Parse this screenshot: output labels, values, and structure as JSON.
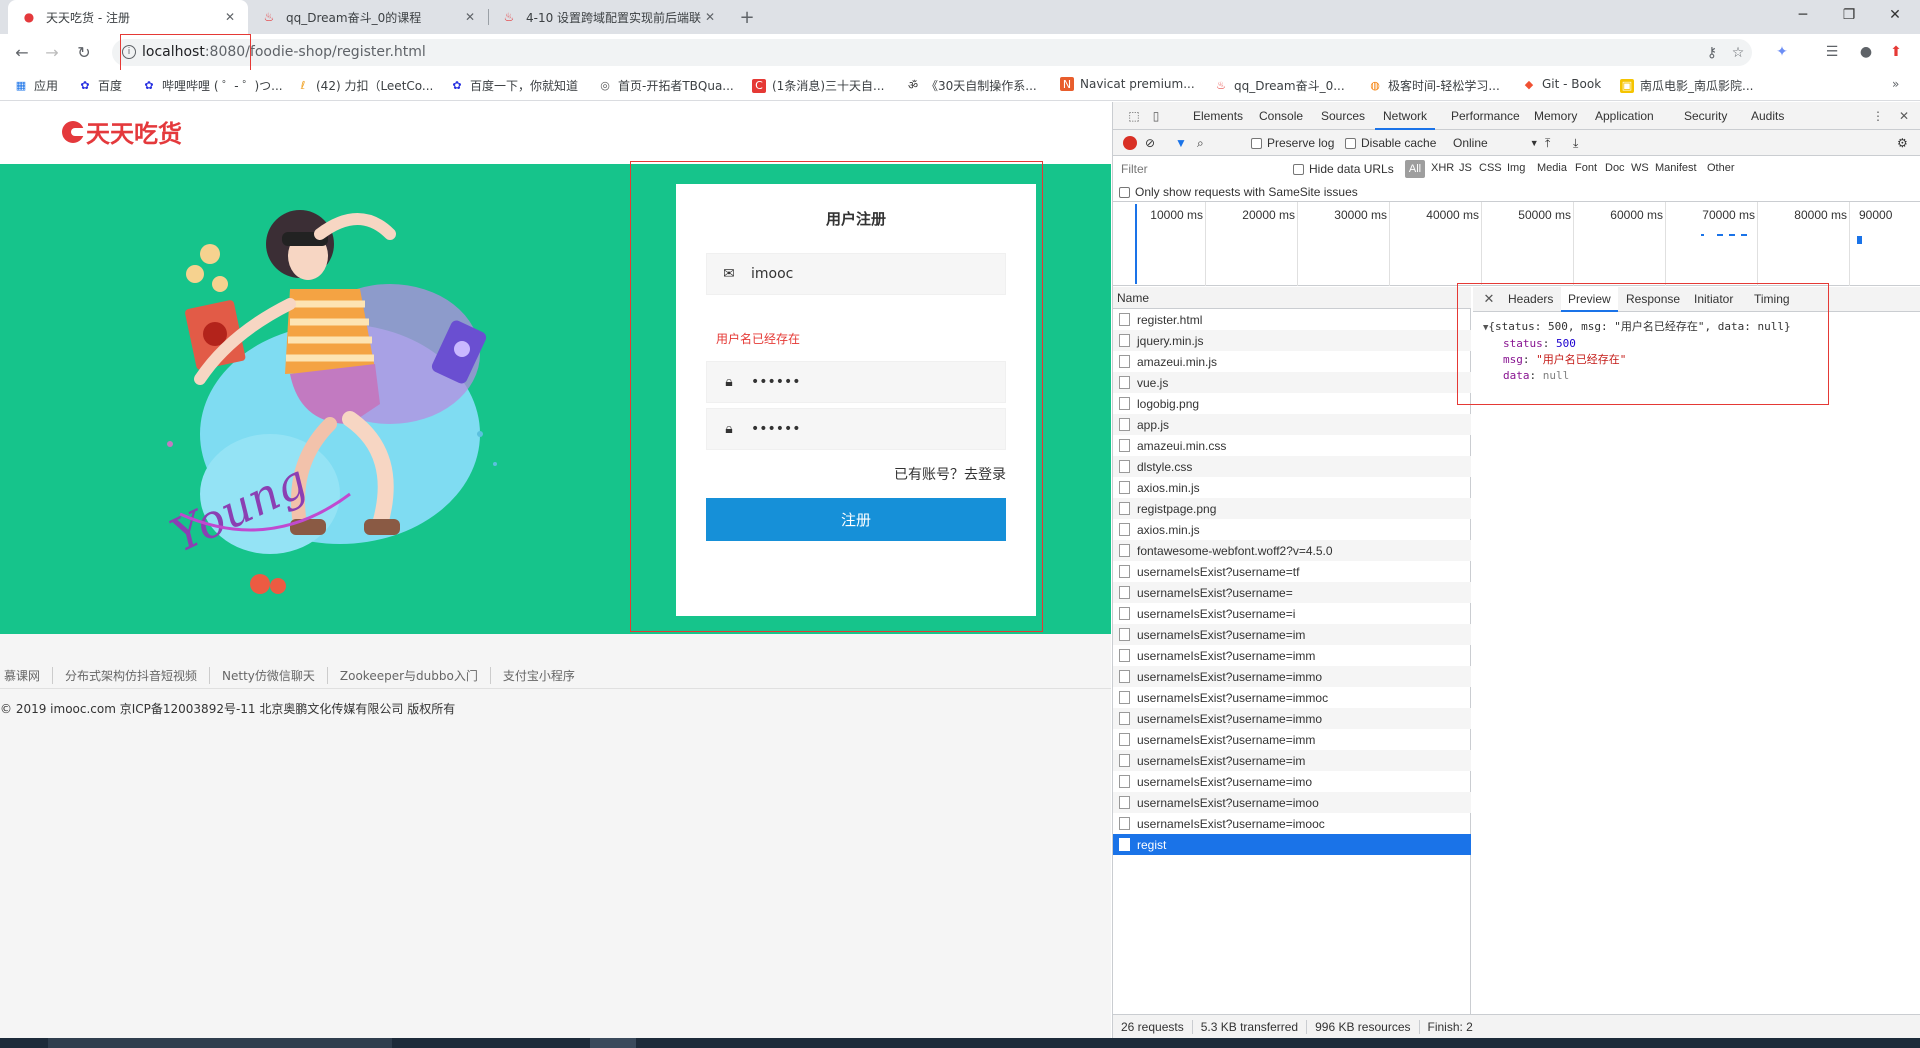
{
  "browser": {
    "tabs": [
      {
        "title": "天天吃货 - 注册",
        "active": true
      },
      {
        "title": "qq_Dream奋斗_0的课程",
        "active": false
      },
      {
        "title": "4-10 设置跨域配置实现前后端联",
        "active": false
      }
    ],
    "url_host": "localhost",
    "url_rest": ":8080/foodie-shop/register.html",
    "bookmarks": [
      "应用",
      "百度",
      "哔哩哔哩 ( ゜- ゜)つ...",
      "(42) 力扣（LeetCo...",
      "百度一下，你就知道",
      "首页-开拓者TBQua...",
      "(1条消息)三十天自...",
      "《30天自制操作系...",
      "Navicat premium...",
      "qq_Dream奋斗_0...",
      "极客时间-轻松学习...",
      "Git - Book",
      "南瓜电影_南瓜影院..."
    ]
  },
  "page": {
    "logo": "天天吃货",
    "form": {
      "title": "用户注册",
      "username_value": "imooc",
      "error_message": "用户名已经存在",
      "password_value": "••••••",
      "confirm_value": "••••••",
      "login_link": "已有账号？去登录",
      "submit_label": "注册"
    },
    "footer_links": [
      "慕课网",
      "分布式架构仿抖音短视频",
      "Netty仿微信聊天",
      "Zookeeper与dubbo入门",
      "支付宝小程序"
    ],
    "copyright": "© 2019 imooc.com 京ICP备12003892号-11 北京奥鹏文化传媒有限公司 版权所有",
    "illustration_text": "Young"
  },
  "devtools": {
    "tabs": [
      "Elements",
      "Console",
      "Sources",
      "Network",
      "Performance",
      "Memory",
      "Application",
      "Security",
      "Audits"
    ],
    "active_tab": "Network",
    "toolbar": {
      "preserve_log": "Preserve log",
      "disable_cache": "Disable cache",
      "throttle": "Online"
    },
    "filter": {
      "placeholder": "Filter",
      "hide_data_urls": "Hide data URLs",
      "types": [
        "All",
        "XHR",
        "JS",
        "CSS",
        "Img",
        "Media",
        "Font",
        "Doc",
        "WS",
        "Manifest",
        "Other"
      ],
      "samesite": "Only show requests with SameSite issues"
    },
    "timeline_labels": [
      "10000 ms",
      "20000 ms",
      "30000 ms",
      "40000 ms",
      "50000 ms",
      "60000 ms",
      "70000 ms",
      "80000 ms",
      "90000"
    ],
    "list_header": "Name",
    "requests": [
      "register.html",
      "jquery.min.js",
      "amazeui.min.js",
      "vue.js",
      "logobig.png",
      "app.js",
      "amazeui.min.css",
      "dlstyle.css",
      "axios.min.js",
      "registpage.png",
      "axios.min.js",
      "fontawesome-webfont.woff2?v=4.5.0",
      "usernameIsExist?username=tf",
      "usernameIsExist?username=",
      "usernameIsExist?username=i",
      "usernameIsExist?username=im",
      "usernameIsExist?username=imm",
      "usernameIsExist?username=immo",
      "usernameIsExist?username=immoc",
      "usernameIsExist?username=immo",
      "usernameIsExist?username=imm",
      "usernameIsExist?username=im",
      "usernameIsExist?username=imo",
      "usernameIsExist?username=imoo",
      "usernameIsExist?username=imooc",
      "regist"
    ],
    "selected_request": "regist",
    "detail_tabs": [
      "Headers",
      "Preview",
      "Response",
      "Initiator",
      "Timing"
    ],
    "detail_active": "Preview",
    "preview": {
      "summary": "{status: 500, msg: \"用户名已经存在\", data: null}",
      "status_key": "status",
      "status_val": "500",
      "msg_key": "msg",
      "msg_val": "\"用户名已经存在\"",
      "data_key": "data",
      "data_val": "null"
    },
    "status_bar": [
      "26 requests",
      "5.3 KB transferred",
      "996 KB resources",
      "Finish: 2"
    ]
  }
}
